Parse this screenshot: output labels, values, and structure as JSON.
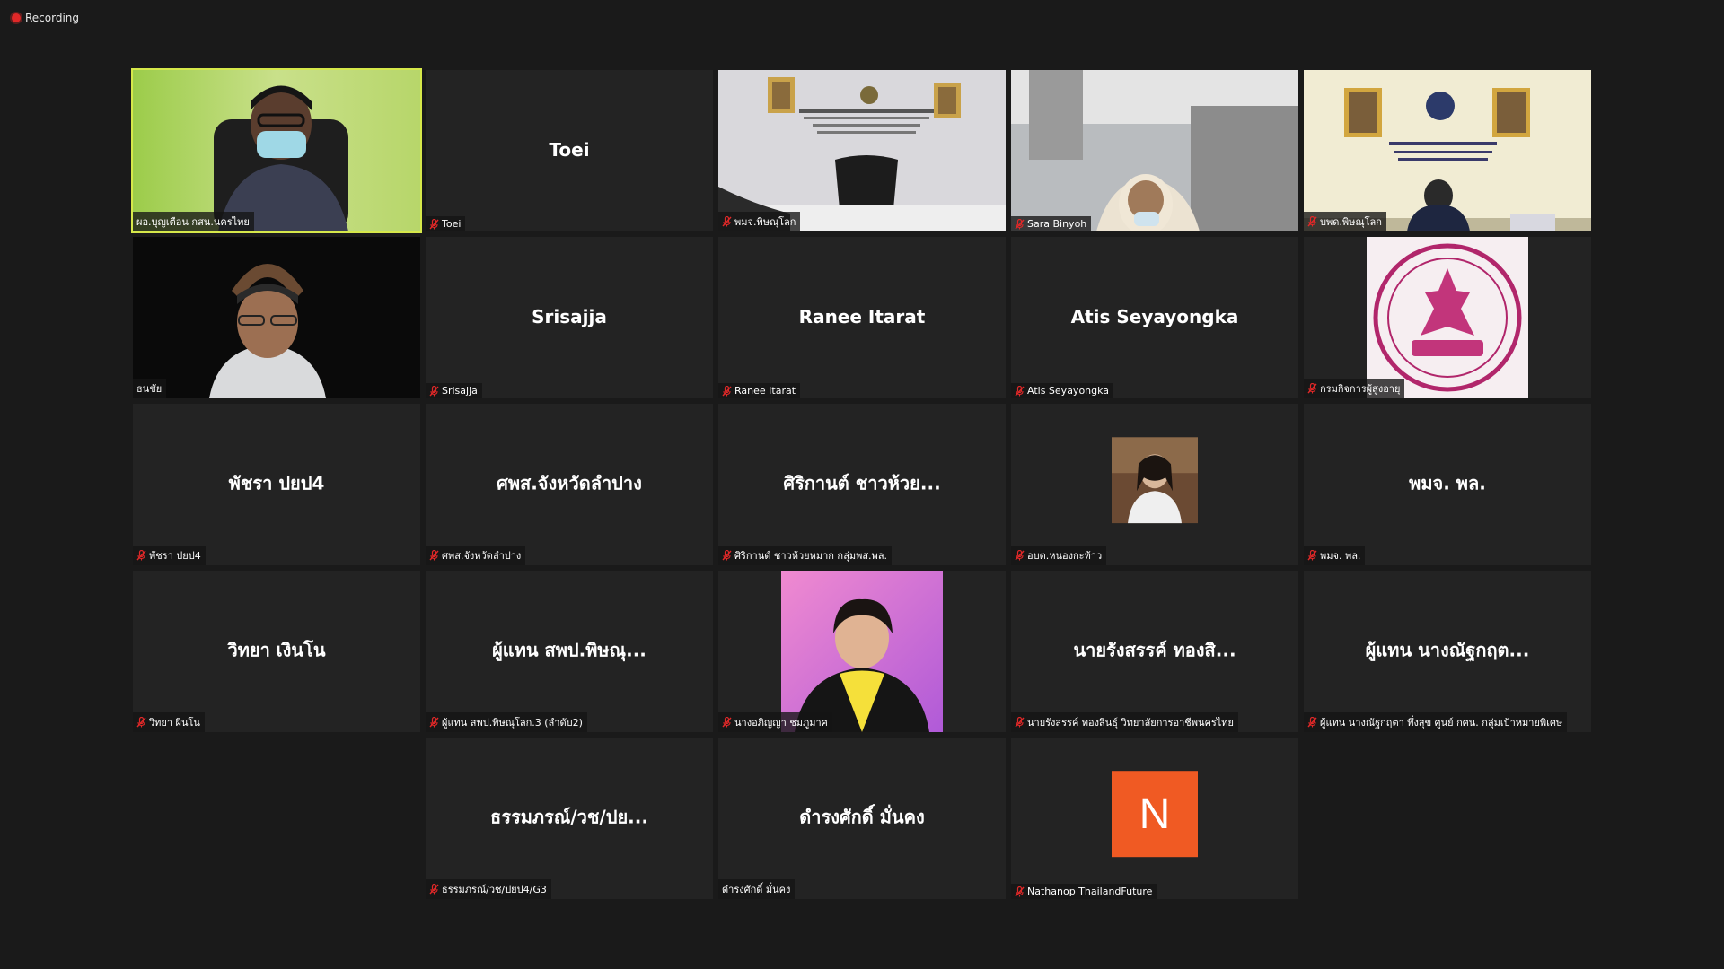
{
  "recording": {
    "label": "Recording"
  },
  "colors": {
    "active_outline": "#d6e84a",
    "tile_bg": "#232323",
    "mute_red": "#e02828",
    "avatar_orange": "#f05a23"
  },
  "participants": [
    {
      "display": "",
      "tag": "ผอ.บุญเตือน กสน.นครไทย",
      "muted": false,
      "kind": "video-woman-mask",
      "active": true
    },
    {
      "display": "Toei",
      "tag": "Toei",
      "muted": true,
      "kind": "name"
    },
    {
      "display": "",
      "tag": "พมจ.พิษณุโลก",
      "muted": true,
      "kind": "video-office-chair"
    },
    {
      "display": "",
      "tag": "Sara Binyoh",
      "muted": true,
      "kind": "video-hijab"
    },
    {
      "display": "",
      "tag": "บพด.พิษณุโลก",
      "muted": true,
      "kind": "video-office-desk"
    },
    {
      "display": "",
      "tag": "ธนชัย",
      "muted": false,
      "kind": "video-man"
    },
    {
      "display": "Srisajja",
      "tag": "Srisajja",
      "muted": true,
      "kind": "name"
    },
    {
      "display": "Ranee Itarat",
      "tag": "Ranee Itarat",
      "muted": true,
      "kind": "name"
    },
    {
      "display": "Atis Seyayongka",
      "tag": "Atis Seyayongka",
      "muted": true,
      "kind": "name"
    },
    {
      "display": "",
      "tag": "กรมกิจการผู้สูงอายุ",
      "muted": true,
      "kind": "logo-seal"
    },
    {
      "display": "พัชรา ปยป4",
      "tag": "พัชรา ปยป4",
      "muted": true,
      "kind": "name"
    },
    {
      "display": "ศพส.จังหวัดลำปาง",
      "tag": "ศพส.จังหวัดลำปาง",
      "muted": true,
      "kind": "name"
    },
    {
      "display": "ศิริกานต์ ชาวห้วย...",
      "tag": "ศิริกานต์ ชาวห้วยหมาก กลุ่มพส.พล.",
      "muted": true,
      "kind": "name"
    },
    {
      "display": "",
      "tag": "อบต.หนองกะท้าว",
      "muted": true,
      "kind": "photo-woman"
    },
    {
      "display": "พมจ. พล.",
      "tag": "พมจ. พล.",
      "muted": true,
      "kind": "name"
    },
    {
      "display": "วิทยา เงินโน",
      "tag": "วิทยา ผินโน",
      "muted": true,
      "kind": "name"
    },
    {
      "display": "ผู้แทน สพป.พิษณุ...",
      "tag": "ผู้แทน สพป.พิษณุโลก.3 (ลำดับ2)",
      "muted": true,
      "kind": "name"
    },
    {
      "display": "",
      "tag": "นางอภิญญา ชมภูมาศ",
      "muted": true,
      "kind": "photo-woman-yellow"
    },
    {
      "display": "นายรังสรรค์ ทองสิ...",
      "tag": "นายรังสรรค์ ทองสินธุ์ วิทยาลัยการอาชีพนครไทย",
      "muted": true,
      "kind": "name"
    },
    {
      "display": "ผู้แทน นางณัฐกฤต...",
      "tag": "ผู้แทน นางณัฐกฤตา พึ่งสุข ศูนย์ กศน. กลุ่มเป้าหมายพิเศษ",
      "muted": true,
      "kind": "name"
    },
    {
      "display": "ธรรมภรณ์/วช/ปย...",
      "tag": "ธรรมภรณ์/วช/ปยป4/G3",
      "muted": true,
      "kind": "name"
    },
    {
      "display": "ดำรงศักดิ์ มั่นคง",
      "tag": "ดำรงศักดิ์ มั่นคง",
      "muted": false,
      "kind": "name"
    },
    {
      "display": "N",
      "tag": "Nathanop ThailandFuture",
      "muted": true,
      "kind": "letter-avatar"
    }
  ]
}
